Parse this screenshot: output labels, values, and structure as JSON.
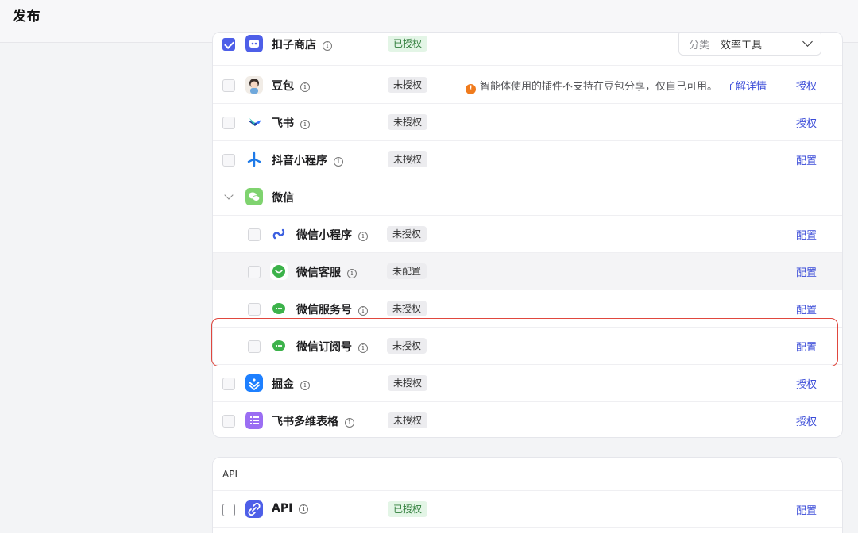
{
  "header": {
    "title": "发布"
  },
  "category": {
    "label": "分类",
    "value": "效率工具"
  },
  "platforms": [
    {
      "name": "扣子商店",
      "status": "已授权",
      "action": "",
      "icon": "coze-store-icon",
      "checked": true
    },
    {
      "name": "豆包",
      "status": "未授权",
      "action": "授权",
      "icon": "doubao-icon",
      "warning": "智能体使用的插件不支持在豆包分享，仅自己可用。",
      "warning_link": "了解详情"
    },
    {
      "name": "飞书",
      "status": "未授权",
      "action": "授权",
      "icon": "feishu-icon"
    },
    {
      "name": "抖音小程序",
      "status": "未授权",
      "action": "配置",
      "icon": "douyin-miniapp-icon"
    },
    {
      "name": "微信",
      "icon": "wechat-icon",
      "expanded": true
    },
    {
      "name": "微信小程序",
      "status": "未授权",
      "action": "配置",
      "icon": "wechat-miniprogram-icon"
    },
    {
      "name": "微信客服",
      "status": "未配置",
      "action": "配置",
      "icon": "wechat-service-icon"
    },
    {
      "name": "微信服务号",
      "status": "未授权",
      "action": "配置",
      "icon": "wechat-official-icon"
    },
    {
      "name": "微信订阅号",
      "status": "未授权",
      "action": "配置",
      "icon": "wechat-subscription-icon"
    },
    {
      "name": "掘金",
      "status": "未授权",
      "action": "授权",
      "icon": "juejin-icon"
    },
    {
      "name": "飞书多维表格",
      "status": "未授权",
      "action": "授权",
      "icon": "feishu-bitable-icon"
    }
  ],
  "api_section": {
    "title": "API",
    "items": [
      {
        "name": "API",
        "status": "已授权",
        "action": "配置",
        "icon": "api-link-icon"
      }
    ]
  },
  "info_glyph": "i",
  "warning_glyph": "!",
  "colors": {
    "accent": "#3a4bd8",
    "checkbox": "#4e5fe8",
    "highlight": "#e0473e",
    "authorized": "#2f7d3a"
  }
}
